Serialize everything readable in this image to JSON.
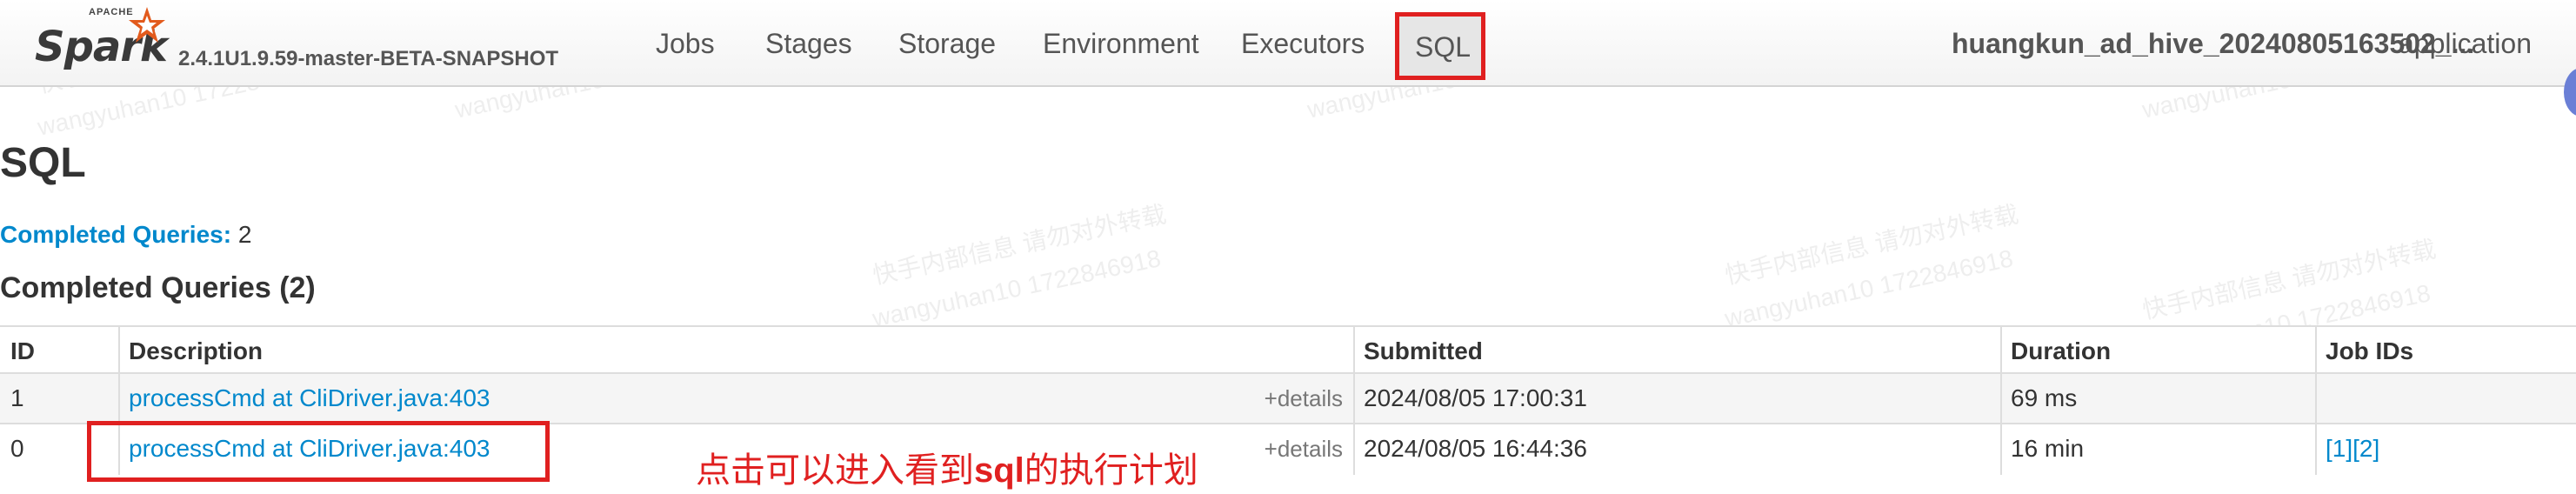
{
  "navbar": {
    "brand_small": "APACHE",
    "brand": "Spark",
    "version": "2.4.1U1.9.59-master-BETA-SNAPSHOT",
    "tabs": [
      {
        "label": "Jobs"
      },
      {
        "label": "Stages"
      },
      {
        "label": "Storage"
      },
      {
        "label": "Environment"
      },
      {
        "label": "Executors"
      },
      {
        "label": "SQL"
      }
    ],
    "active_tab": "SQL",
    "app_name": "huangkun_ad_hive_20240805163502_...",
    "app_suffix": "application"
  },
  "page": {
    "title": "SQL",
    "summary_label": "Completed Queries:",
    "summary_value": "2",
    "section_title": "Completed Queries (2)"
  },
  "table": {
    "headers": [
      "ID",
      "Description",
      "Submitted",
      "Duration",
      "Job IDs"
    ],
    "rows": [
      {
        "id": "1",
        "description": "processCmd at CliDriver.java:403",
        "details": "+details",
        "submitted": "2024/08/05 17:00:31",
        "duration": "69 ms",
        "job_ids": ""
      },
      {
        "id": "0",
        "description": "processCmd at CliDriver.java:403",
        "details": "+details",
        "submitted": "2024/08/05 16:44:36",
        "duration": "16 min",
        "job_ids": "[1][2]"
      }
    ]
  },
  "annotation": {
    "prefix": "点击可以进入看到",
    "keyword": "sql",
    "suffix": "的执行计划"
  },
  "watermark": {
    "line1": "快手内部信息 请勿对外转载",
    "line2": "wangyuhan10 1722846918"
  },
  "colors": {
    "link": "#0088cc",
    "highlight": "#e02020",
    "navbar_bg": "#f3f3f3"
  },
  "icons": [
    "spark-star-logo-icon"
  ]
}
